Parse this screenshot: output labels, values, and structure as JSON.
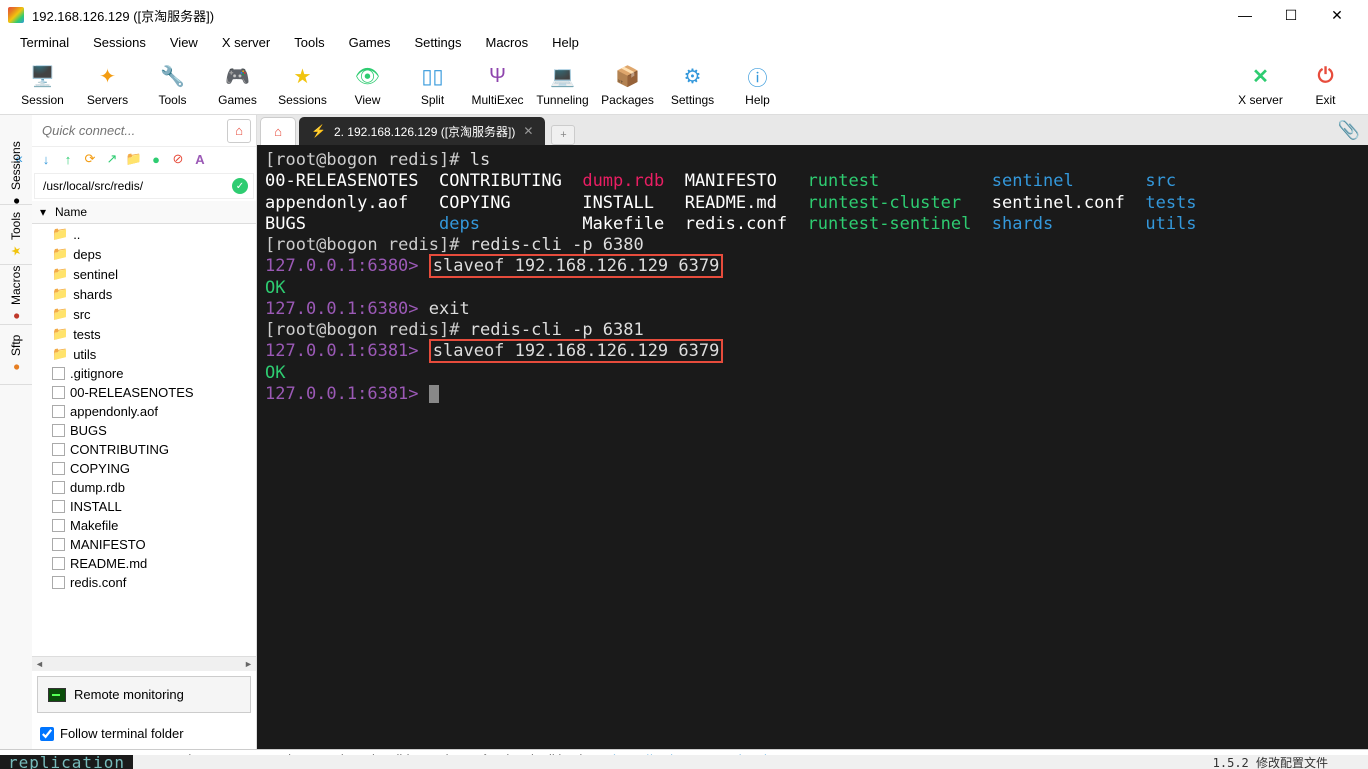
{
  "window": {
    "title": "192.168.126.129 ([京淘服务器])",
    "minimize": "—",
    "maximize": "☐",
    "close": "✕"
  },
  "menu": [
    "Terminal",
    "Sessions",
    "View",
    "X server",
    "Tools",
    "Games",
    "Settings",
    "Macros",
    "Help"
  ],
  "toolbar": [
    {
      "label": "Session",
      "icon": "🖥️",
      "color": "#3498db"
    },
    {
      "label": "Servers",
      "icon": "✦",
      "color": "#f39c12"
    },
    {
      "label": "Tools",
      "icon": "🔧",
      "color": "#e74c3c"
    },
    {
      "label": "Games",
      "icon": "🎮",
      "color": "#555"
    },
    {
      "label": "Sessions",
      "icon": "★",
      "color": "#f1c40f"
    },
    {
      "label": "View",
      "icon": "👁",
      "color": "#2ecc71"
    },
    {
      "label": "Split",
      "icon": "▯▯",
      "color": "#3498db"
    },
    {
      "label": "MultiExec",
      "icon": "Ψ",
      "color": "#8e44ad"
    },
    {
      "label": "Tunneling",
      "icon": "💻",
      "color": "#3498db"
    },
    {
      "label": "Packages",
      "icon": "📦",
      "color": "#c0392b"
    },
    {
      "label": "Settings",
      "icon": "⚙",
      "color": "#3498db"
    },
    {
      "label": "Help",
      "icon": "ⓘ",
      "color": "#3498db"
    }
  ],
  "toolbar_right": [
    {
      "label": "X server",
      "icon": "✕",
      "color": "#2ecc71"
    },
    {
      "label": "Exit",
      "icon": "⏻",
      "color": "#e74c3c"
    }
  ],
  "quick_connect_placeholder": "Quick connect...",
  "sftp_icons": [
    "↓",
    "↑",
    "⟳",
    "↗",
    "📁",
    "●",
    "⊘",
    "A"
  ],
  "path": "/usr/local/src/redis/",
  "name_header": "Name",
  "files": [
    {
      "name": "..",
      "type": "folder-green"
    },
    {
      "name": "deps",
      "type": "folder"
    },
    {
      "name": "sentinel",
      "type": "folder"
    },
    {
      "name": "shards",
      "type": "folder"
    },
    {
      "name": "src",
      "type": "folder"
    },
    {
      "name": "tests",
      "type": "folder"
    },
    {
      "name": "utils",
      "type": "folder"
    },
    {
      "name": ".gitignore",
      "type": "file"
    },
    {
      "name": "00-RELEASENOTES",
      "type": "file"
    },
    {
      "name": "appendonly.aof",
      "type": "file"
    },
    {
      "name": "BUGS",
      "type": "file"
    },
    {
      "name": "CONTRIBUTING",
      "type": "file"
    },
    {
      "name": "COPYING",
      "type": "file"
    },
    {
      "name": "dump.rdb",
      "type": "file"
    },
    {
      "name": "INSTALL",
      "type": "file"
    },
    {
      "name": "Makefile",
      "type": "file"
    },
    {
      "name": "MANIFESTO",
      "type": "file"
    },
    {
      "name": "README.md",
      "type": "file"
    },
    {
      "name": "redis.conf",
      "type": "file"
    }
  ],
  "side_tabs": [
    "Sessions",
    "Tools",
    "Macros",
    "Sftp"
  ],
  "side_tab_colors": [
    "#444",
    "#f1c40f",
    "#c0392b",
    "#e67e22"
  ],
  "remote_monitoring": "Remote monitoring",
  "follow_terminal": "Follow terminal folder",
  "home_icon": "⌂",
  "tab_title": "2.  192.168.126.129 ([京淘服务器])",
  "tab_close": "✕",
  "tab_plus": "+",
  "paperclip": "📎",
  "terminal": {
    "p1_user": "[root@bogon ",
    "p1_path": "redis",
    "p1_end": "]# ",
    "p1_cmd": "ls",
    "ls_row": [
      [
        "00-RELEASENOTES",
        "CONTRIBUTING",
        "dump.rdb",
        "MANIFESTO "
      ],
      [
        "appendonly.aof ",
        "COPYING     ",
        "INSTALL ",
        "README.md "
      ],
      [
        "BUGS           ",
        "",
        "Makefile",
        "redis.conf"
      ]
    ],
    "ls_deps": "deps        ",
    "ls_green": [
      "runtest         ",
      "runtest-cluster ",
      "runtest-sentinel"
    ],
    "ls_cyan": [
      "sentinel     ",
      "",
      "shards       "
    ],
    "ls_sentinelconf": "sentinel.conf",
    "ls_right": [
      "src  ",
      "tests",
      "utils"
    ],
    "p2_user": "[root@bogon ",
    "p2_path": "redis",
    "p2_end": "]# ",
    "p2_cmd": "redis-cli -p 6380",
    "p3_prompt": "127.0.0.1:6380> ",
    "p3_box": "slaveof 192.168.126.129 6379",
    "ok": "OK",
    "p4_prompt": "127.0.0.1:6380> ",
    "p4_cmd": "exit",
    "p5_user": "[root@bogon ",
    "p5_path": "redis",
    "p5_end": "]# ",
    "p5_cmd": "redis-cli -p 6381",
    "p6_prompt": "127.0.0.1:6381> ",
    "p6_box": "slaveof 192.168.126.129 6379",
    "p7_prompt": "127.0.0.1:6381> "
  },
  "status": {
    "unreg": "UNREGISTERED VERSION",
    "dash": "  -  ",
    "text": "Please support MobaXterm by subscribing to the professional edition here:  ",
    "link": "https://mobaxterm.mobatek.net"
  },
  "bg_bottom_left": "replication",
  "bg_bottom_right": "1.5.2 修改配置文件"
}
